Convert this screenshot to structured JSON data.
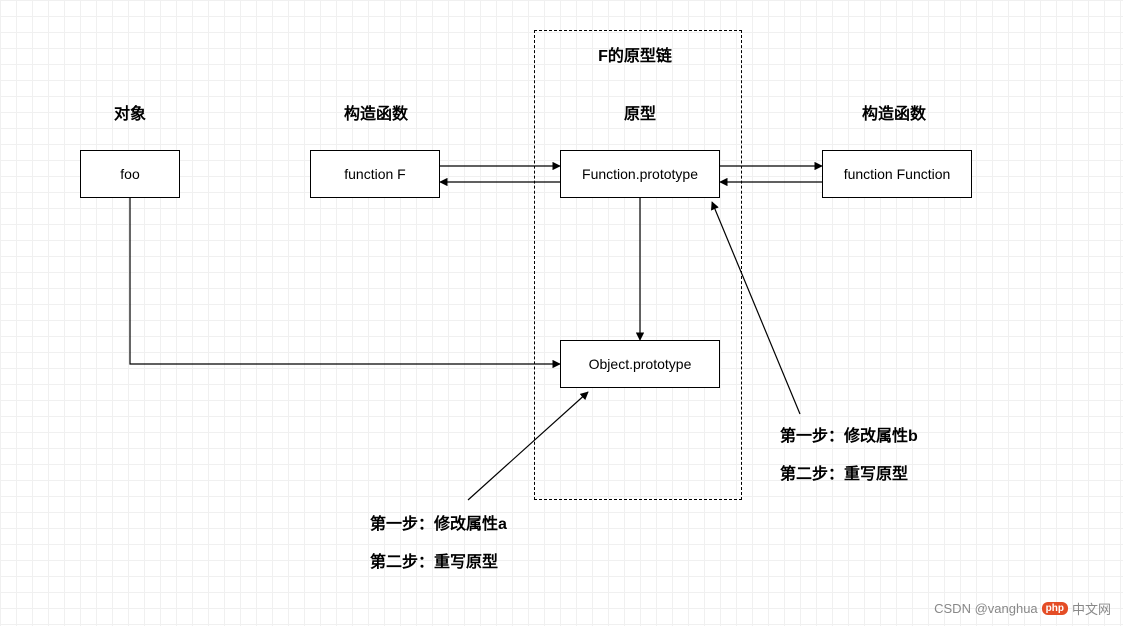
{
  "headers": {
    "col1": "对象",
    "col2": "构造函数",
    "col3_title": "F的原型链",
    "col3": "原型",
    "col4": "构造函数"
  },
  "nodes": {
    "foo": "foo",
    "functionF": "function F",
    "functionPrototype": "Function.prototype",
    "functionFunction": "function Function",
    "objectPrototype": "Object.prototype"
  },
  "annotations": {
    "left": {
      "line1": "第一步：修改属性a",
      "line2": "第二步：重写原型"
    },
    "right": {
      "line1": "第一步：修改属性b",
      "line2": "第二步：重写原型"
    }
  },
  "footer": {
    "leftAuthor": "CSDN @vanghua",
    "rightBrand": "中文网",
    "rightBadge": "php"
  },
  "chart_data": {
    "type": "diagram",
    "title": "F的原型链",
    "columns": [
      "对象",
      "构造函数",
      "原型",
      "构造函数"
    ],
    "nodes": [
      {
        "id": "foo",
        "label": "foo",
        "column": "对象"
      },
      {
        "id": "functionF",
        "label": "function F",
        "column": "构造函数"
      },
      {
        "id": "functionPrototype",
        "label": "Function.prototype",
        "column": "原型"
      },
      {
        "id": "functionFunction",
        "label": "function Function",
        "column": "构造函数(2)"
      },
      {
        "id": "objectPrototype",
        "label": "Object.prototype",
        "column": "原型"
      }
    ],
    "edges": [
      {
        "from": "foo",
        "to": "objectPrototype",
        "style": "path"
      },
      {
        "from": "functionF",
        "to": "functionPrototype",
        "style": "bidirectional"
      },
      {
        "from": "functionPrototype",
        "to": "functionFunction",
        "style": "bidirectional"
      },
      {
        "from": "functionPrototype",
        "to": "objectPrototype",
        "style": "down"
      },
      {
        "from": "annotation_left",
        "to": "objectPrototype",
        "style": "pointer",
        "text": [
          "第一步：修改属性a",
          "第二步：重写原型"
        ]
      },
      {
        "from": "annotation_right",
        "to": "functionPrototype",
        "style": "pointer",
        "text": [
          "第一步：修改属性b",
          "第二步：重写原型"
        ]
      }
    ],
    "container": {
      "around": [
        "functionPrototype",
        "objectPrototype"
      ],
      "label": "F的原型链",
      "style": "dashed"
    }
  }
}
